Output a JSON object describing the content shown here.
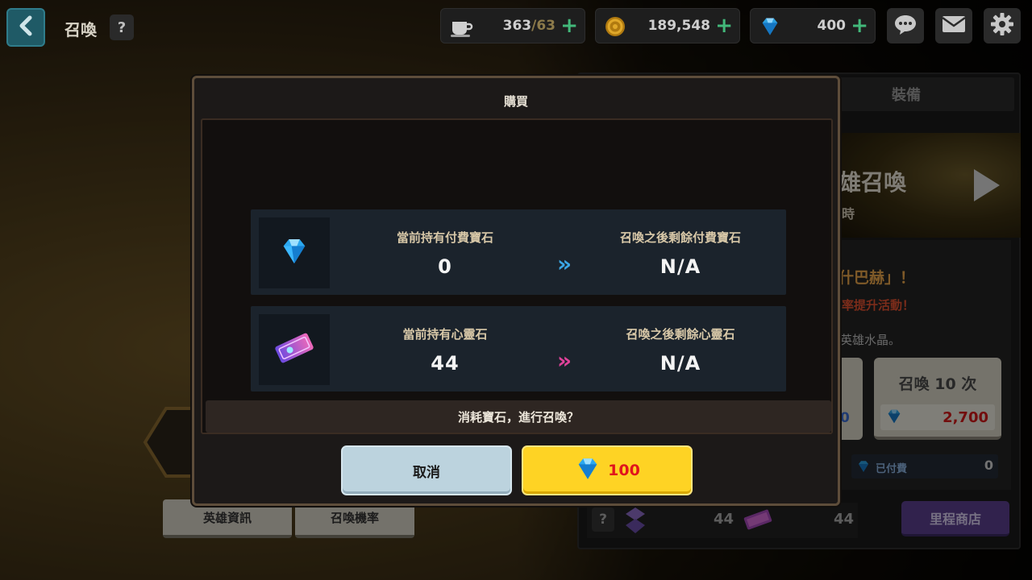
{
  "header": {
    "title": "召喚",
    "help_label": "?",
    "resources": [
      {
        "icon": "coffee-cup-icon",
        "value": "363",
        "max": "/63"
      },
      {
        "icon": "gold-coin-icon",
        "value": "189,548"
      },
      {
        "icon": "blue-gem-icon",
        "value": "400"
      }
    ]
  },
  "right_panel": {
    "tab_equip": "裝備",
    "banner_title": "雄召喚",
    "banner_sub": "時",
    "promo_line1": "什巴赫」！",
    "promo_line2": "率提升活動！",
    "promo_line3": "英雄水晶。",
    "summon1_price": "0",
    "summon10_label": "召喚 10 次",
    "summon10_price": "2,700",
    "paid_label": "已付費",
    "paid_value": "0",
    "help_label": "?",
    "count_purple": "44",
    "count_ticket": "44",
    "mileage_shop": "里程商店"
  },
  "left_buttons": {
    "hero_info": "英雄資訊",
    "summon_rate": "召喚機率"
  },
  "dialog": {
    "title": "購買",
    "rows": [
      {
        "current_label": "當前持有付費寶石",
        "current_value": "0",
        "after_label": "召喚之後剩餘付費寶石",
        "after_value": "N/A",
        "arrow": "»",
        "arrow_color": "#3ba7e6"
      },
      {
        "current_label": "當前持有心靈石",
        "current_value": "44",
        "after_label": "召喚之後剩餘心靈石",
        "after_value": "N/A",
        "arrow": "»",
        "arrow_color": "#e0429a"
      }
    ],
    "confirm_text": "消耗寶石，進行召喚？",
    "cancel_label": "取消",
    "confirm_price": "100"
  },
  "colors": {
    "confirm_button": "#fed324",
    "cancel_button": "#bcd3de",
    "price_text": "#e0151c"
  }
}
